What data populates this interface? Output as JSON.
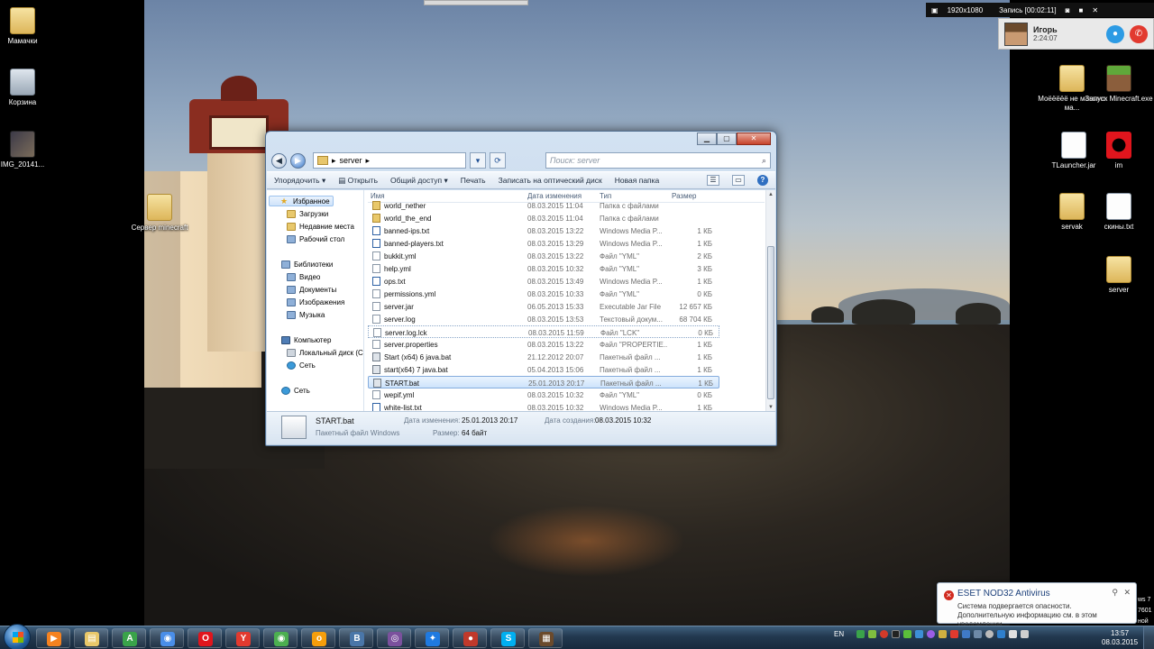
{
  "desktop": {
    "icons_left": [
      {
        "label": "Мамачки",
        "icon": "folder-icon"
      },
      {
        "label": "Корзина",
        "icon": "recycle-bin-icon"
      },
      {
        "label": "IMG_20141...",
        "icon": "image-icon"
      },
      {
        "label": "Сервер minecraft",
        "icon": "folder-icon"
      }
    ],
    "icons_right": [
      {
        "label": "Моёёёёё не мамино ма...",
        "icon": "folder-icon"
      },
      {
        "label": "Запуск Minecraft.exe",
        "icon": "minecraft-icon"
      },
      {
        "label": "TLauncher.jar",
        "icon": "jar-icon"
      },
      {
        "label": "im",
        "icon": "opera-icon"
      },
      {
        "label": "servak",
        "icon": "folder-icon"
      },
      {
        "label": "скины.txt",
        "icon": "text-file-icon"
      },
      {
        "label": "server",
        "icon": "folder-icon"
      }
    ]
  },
  "recorder": {
    "resolution": "1920x1080",
    "status": "Запись [00:02:11]",
    "caller_name": "Игорь",
    "call_time": "2:24:07"
  },
  "explorer": {
    "path": "server",
    "search_placeholder": "Поиск: server",
    "toolbar": {
      "organize": "Упорядочить ▾",
      "open": "Открыть",
      "share": "Общий доступ ▾",
      "print": "Печать",
      "burn": "Записать на оптический диск",
      "new_folder": "Новая папка"
    },
    "nav": {
      "favorites": "Избранное",
      "downloads": "Загрузки",
      "recent": "Недавние места",
      "desktop": "Рабочий стол",
      "libraries": "Библиотеки",
      "video": "Видео",
      "documents": "Документы",
      "pictures": "Изображения",
      "music": "Музыка",
      "computer": "Компьютер",
      "local_disk": "Локальный диск (С",
      "network_sub": "Сеть",
      "network": "Сеть"
    },
    "columns": {
      "name": "Имя",
      "date": "Дата изменения",
      "type": "Тип",
      "size": "Размер"
    },
    "files": [
      {
        "name": "world_nether",
        "date": "08.03.2015 11:04",
        "type": "Папка с файлами",
        "size": "",
        "kind": "folder"
      },
      {
        "name": "world_the_end",
        "date": "08.03.2015 11:04",
        "type": "Папка с файлами",
        "size": "",
        "kind": "folder"
      },
      {
        "name": "banned-ips.txt",
        "date": "08.03.2015 13:22",
        "type": "Windows Media P...",
        "size": "1 КБ",
        "kind": "media"
      },
      {
        "name": "banned-players.txt",
        "date": "08.03.2015 13:29",
        "type": "Windows Media P...",
        "size": "1 КБ",
        "kind": "media"
      },
      {
        "name": "bukkit.yml",
        "date": "08.03.2015 13:22",
        "type": "Файл \"YML\"",
        "size": "2 КБ",
        "kind": "file"
      },
      {
        "name": "help.yml",
        "date": "08.03.2015 10:32",
        "type": "Файл \"YML\"",
        "size": "3 КБ",
        "kind": "file"
      },
      {
        "name": "ops.txt",
        "date": "08.03.2015 13:49",
        "type": "Windows Media P...",
        "size": "1 КБ",
        "kind": "media"
      },
      {
        "name": "permissions.yml",
        "date": "08.03.2015 10:33",
        "type": "Файл \"YML\"",
        "size": "0 КБ",
        "kind": "file"
      },
      {
        "name": "server.jar",
        "date": "06.05.2013 15:33",
        "type": "Executable Jar File",
        "size": "12 657 КБ",
        "kind": "file"
      },
      {
        "name": "server.log",
        "date": "08.03.2015 13:53",
        "type": "Текстовый докум...",
        "size": "68 704 КБ",
        "kind": "file"
      },
      {
        "name": "server.log.lck",
        "date": "08.03.2015 11:59",
        "type": "Файл \"LCK\"",
        "size": "0 КБ",
        "kind": "file"
      },
      {
        "name": "server.properties",
        "date": "08.03.2015 13:22",
        "type": "Файл \"PROPERTIE...",
        "size": "1 КБ",
        "kind": "file"
      },
      {
        "name": "Start (x64) 6 java.bat",
        "date": "21.12.2012 20:07",
        "type": "Пакетный файл ...",
        "size": "1 КБ",
        "kind": "bat"
      },
      {
        "name": "start(x64) 7 java.bat",
        "date": "05.04.2013 15:06",
        "type": "Пакетный файл ...",
        "size": "1 КБ",
        "kind": "bat"
      },
      {
        "name": "START.bat",
        "date": "25.01.2013 20:17",
        "type": "Пакетный файл ...",
        "size": "1 КБ",
        "kind": "bat"
      },
      {
        "name": "wepif.yml",
        "date": "08.03.2015 10:32",
        "type": "Файл \"YML\"",
        "size": "0 КБ",
        "kind": "file"
      },
      {
        "name": "white-list.txt",
        "date": "08.03.2015 10:32",
        "type": "Windows Media P...",
        "size": "1 КБ",
        "kind": "media"
      }
    ],
    "selected_file": "START.bat",
    "details": {
      "name": "START.bat",
      "type": "Пакетный файл Windows",
      "modified_label": "Дата изменения:",
      "modified": "25.01.2013 20:17",
      "created_label": "Дата создания:",
      "created": "08.03.2015 10:32",
      "size_label": "Размер:",
      "size": "64 байт"
    }
  },
  "notification": {
    "title": "ESET NOD32 Antivirus",
    "message": "Система подвергается опасности. Дополнительную информацию см. в этом уведомлении."
  },
  "side_text": {
    "line1": "ws 7",
    "line2": "7601",
    "line3": "ной"
  },
  "taskbar": {
    "lang": "EN",
    "time": "13:57",
    "date": "08.03.2015",
    "apps": [
      "media-player-icon",
      "explorer-icon",
      "tlauncher-icon",
      "chrome-icon",
      "opera-icon",
      "yandex-icon",
      "chromium-icon",
      "odnoklassniki-icon",
      "vk-icon",
      "viber-icon",
      "teamviewer-icon",
      "recorder-icon",
      "skype-icon",
      "minecraft-icon"
    ]
  },
  "colors": {
    "accent": "#3a78c8",
    "selection": "#cde3fb",
    "taskbar": "#22384f"
  }
}
